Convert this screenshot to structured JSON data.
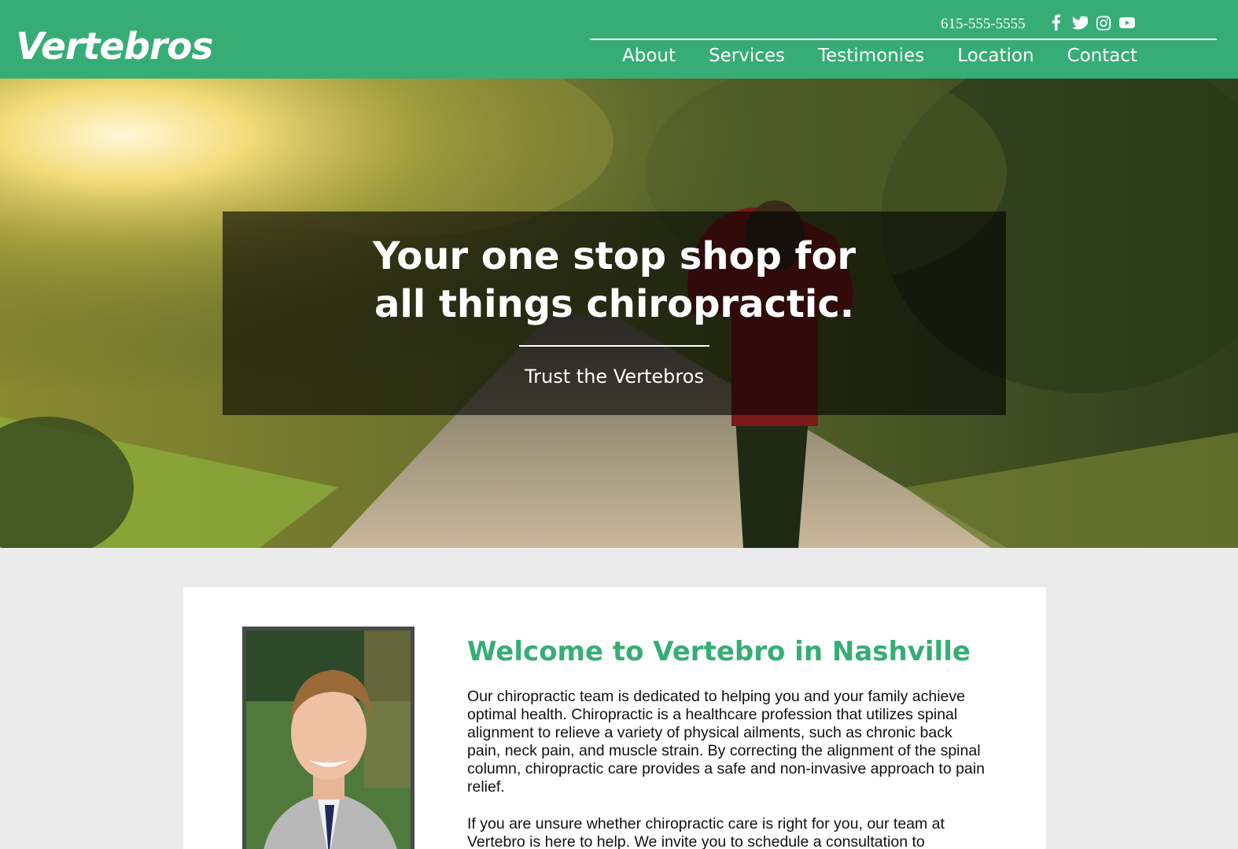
{
  "header": {
    "logo": "Vertebros",
    "phone": "615-555-5555",
    "social_icons": [
      "facebook-icon",
      "twitter-icon",
      "instagram-icon",
      "youtube-icon"
    ],
    "nav": [
      "About",
      "Services",
      "Testimonies",
      "Location",
      "Contact"
    ],
    "background_color": "#37ad76"
  },
  "hero": {
    "title_line1": "Your one stop shop for",
    "title_line2": "all things chiropractic.",
    "subtitle": "Trust the Vertebros"
  },
  "welcome": {
    "heading": "Welcome to Vertebro in Nashville",
    "paragraph1": "Our chiropractic team is dedicated to helping you and your family achieve optimal health. Chiropractic is a healthcare profession that utilizes spinal alignment to relieve a variety of physical ailments, such as chronic back pain, neck pain, and muscle strain. By correcting the alignment of the spinal column, chiropractic care provides a safe and non-invasive approach to pain relief.",
    "paragraph2": "If you are unsure whether chiropractic care is right for you, our team at Vertebro is here to help. We invite you to schedule a consultation to",
    "accent_color": "#37ad76"
  }
}
